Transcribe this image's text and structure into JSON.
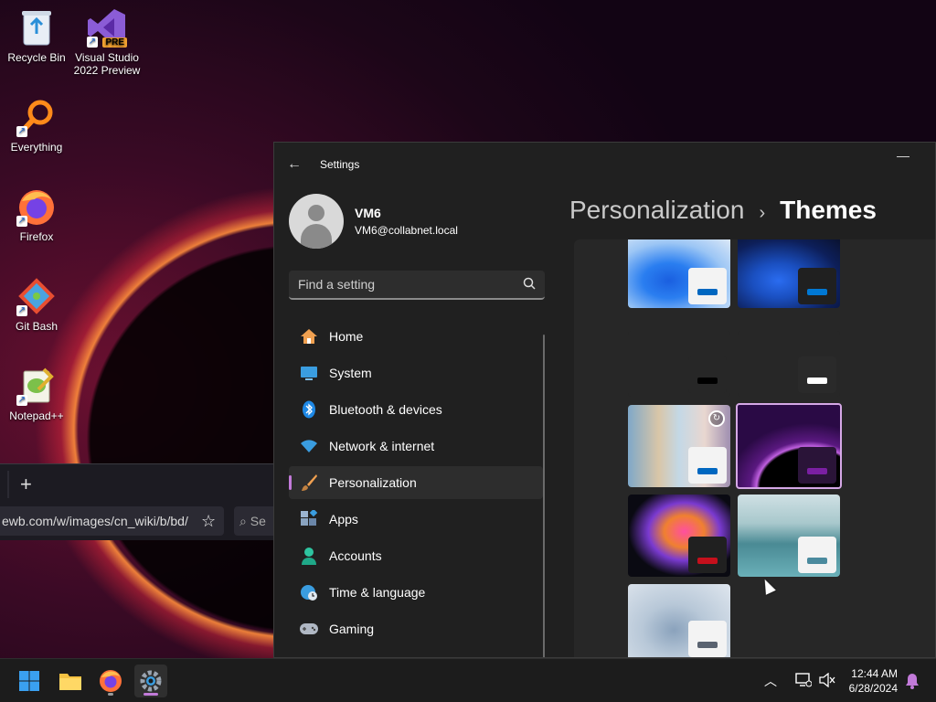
{
  "desktop": {
    "icons": [
      {
        "label": "Recycle Bin",
        "icon": "recycle-bin-icon"
      },
      {
        "label": "Visual Studio 2022 Preview",
        "badge": "PRE",
        "icon": "visual-studio-icon"
      },
      {
        "label": "Everything",
        "icon": "everything-search-icon"
      },
      {
        "label": "Firefox",
        "icon": "firefox-icon"
      },
      {
        "label": "Git Bash",
        "icon": "git-bash-icon"
      },
      {
        "label": "Notepad++",
        "icon": "notepad-plus-plus-icon"
      }
    ]
  },
  "background_browser": {
    "new_tab_label": "+",
    "url": "ewb.com/w/images/cn_wiki/b/bd/",
    "search_placeholder": "Se"
  },
  "settings": {
    "app_title": "Settings",
    "user": {
      "name": "VM6",
      "email": "VM6@collabnet.local"
    },
    "search": {
      "placeholder": "Find a setting"
    },
    "nav": [
      {
        "label": "Home",
        "icon": "home-icon"
      },
      {
        "label": "System",
        "icon": "system-icon"
      },
      {
        "label": "Bluetooth & devices",
        "icon": "bluetooth-icon"
      },
      {
        "label": "Network & internet",
        "icon": "wifi-icon"
      },
      {
        "label": "Personalization",
        "icon": "paintbrush-icon",
        "active": true
      },
      {
        "label": "Apps",
        "icon": "apps-icon"
      },
      {
        "label": "Accounts",
        "icon": "accounts-icon"
      },
      {
        "label": "Time & language",
        "icon": "globe-clock-icon"
      },
      {
        "label": "Gaming",
        "icon": "gamepad-icon"
      }
    ],
    "breadcrumb": {
      "parent": "Personalization",
      "separator": "›",
      "current": "Themes"
    },
    "themes": [
      {
        "name": "windows-light-bloom",
        "accent": "#0067c0"
      },
      {
        "name": "windows-dark-bloom",
        "accent": "#0078d4"
      },
      {
        "name": "black-bar-theme",
        "accent": "#000000"
      },
      {
        "name": "white-bar-theme",
        "accent": "#ffffff"
      },
      {
        "name": "spotlight-slideshow",
        "accent": "#0067c0",
        "slideshow": true
      },
      {
        "name": "glow-purple",
        "accent": "#7a1fa2",
        "selected": true
      },
      {
        "name": "captured-motion",
        "accent": "#c5101c"
      },
      {
        "name": "flow-lake",
        "accent": "#4a8a9e"
      },
      {
        "name": "sunrise-gray",
        "accent": "#5a6370"
      }
    ]
  },
  "taskbar": {
    "apps": [
      {
        "name": "start",
        "icon": "windows-start-icon"
      },
      {
        "name": "file-explorer",
        "icon": "folder-icon"
      },
      {
        "name": "firefox",
        "icon": "firefox-icon"
      },
      {
        "name": "settings",
        "icon": "settings-gear-icon",
        "active": true
      }
    ],
    "time": "12:44 AM",
    "date": "6/28/2024"
  },
  "colors": {
    "accent": "#c27ad9",
    "window_bg": "#202020",
    "taskbar_bg": "#1c1c1c"
  }
}
